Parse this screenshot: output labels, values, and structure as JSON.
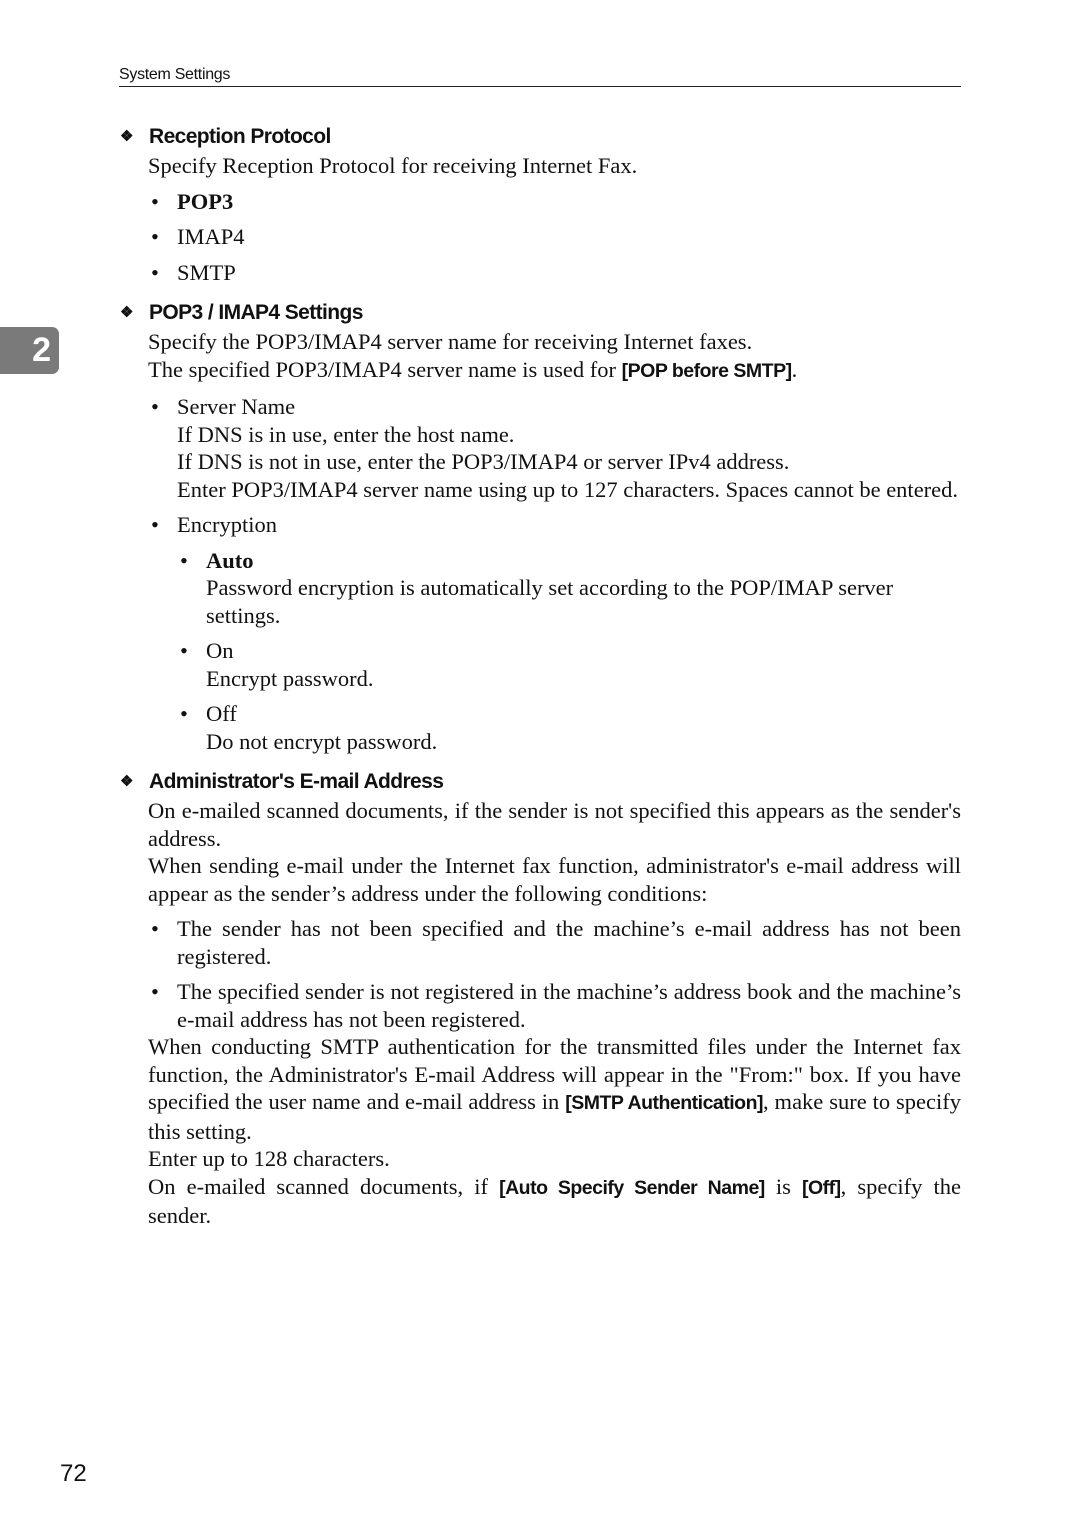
{
  "header": {
    "title": "System Settings"
  },
  "chapter_tab": {
    "number": "2"
  },
  "page_number": "72",
  "icons": {
    "section_marker": "diamond-cluster-icon",
    "bullet": "bullet-dot"
  },
  "sections": {
    "reception": {
      "title": "Reception Protocol",
      "description": "Specify Reception Protocol for receiving Internet Fax.",
      "options": [
        "POP3",
        "IMAP4",
        "SMTP"
      ],
      "default_option": "POP3"
    },
    "pop3imap4": {
      "title": "POP3 / IMAP4 Settings",
      "line1": "Specify the POP3/IMAP4 server name for receiving Internet faxes.",
      "line2_pre": "The specified POP3/IMAP4 server name is used for ",
      "line2_kw": "[POP before SMTP]",
      "line2_post": ".",
      "server_name": {
        "label": "Server Name",
        "lines": [
          "If DNS is in use, enter the host name.",
          "If DNS is not in use, enter the POP3/IMAP4 or server IPv4 address.",
          "Enter POP3/IMAP4 server name using up to 127 characters. Spaces cannot be entered."
        ]
      },
      "encryption": {
        "label": "Encryption",
        "options": [
          {
            "label": "Auto",
            "desc": "Password encryption is automatically set according to the POP/IMAP server settings."
          },
          {
            "label": "On",
            "desc": "Encrypt password."
          },
          {
            "label": "Off",
            "desc": "Do not encrypt password."
          }
        ]
      }
    },
    "admin_email": {
      "title": "Administrator's E-mail Address",
      "p1": "On e-mailed scanned documents, if the sender is not specified this appears as the sender's address.",
      "p2": "When sending e-mail under the Internet fax function, administrator's e-mail address will appear as the sender’s address under the following conditions:",
      "conditions": [
        "The sender has not been specified and the machine’s e-mail address has not been registered.",
        "The specified sender is not registered in the machine’s address book and the machine’s e-mail address has not been registered."
      ],
      "p3_pre": "When conducting SMTP authentication for the transmitted files under the Internet fax function, the Administrator's E-mail Address will appear in the \"From:\" box. If you have specified the user name and e-mail address in ",
      "p3_kw": "[SMTP Authentication]",
      "p3_post": ", make sure to specify this setting.",
      "p4": "Enter up to 128 characters.",
      "p5_pre": "On e-mailed scanned documents, if ",
      "p5_kw1": "[Auto Specify Sender Name]",
      "p5_mid": " is ",
      "p5_kw2": "[Off]",
      "p5_post": ", specify the sender."
    }
  }
}
